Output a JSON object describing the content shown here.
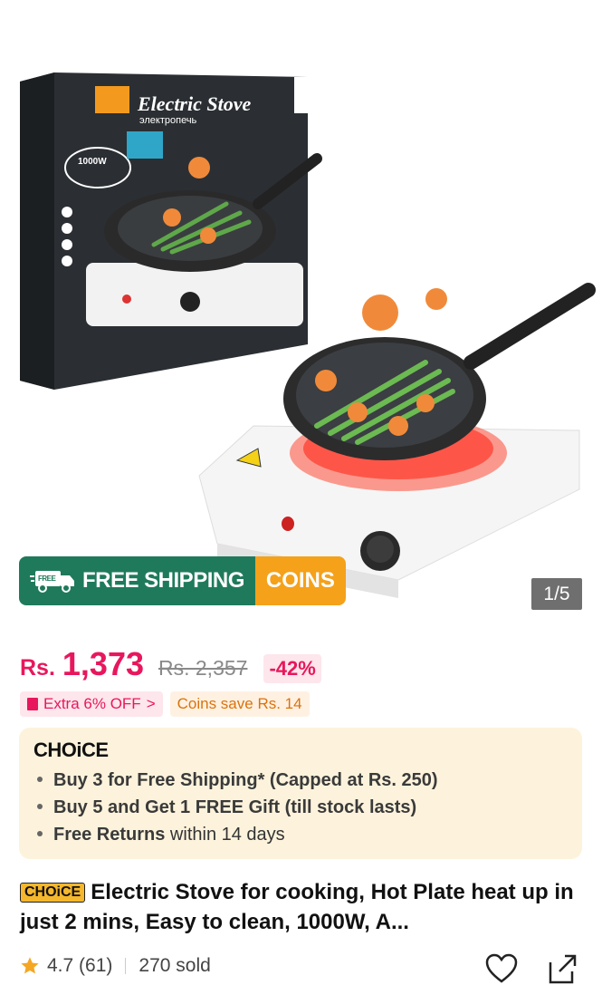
{
  "hero": {
    "box_title": "Electric Stove",
    "box_subtitle": "электропечь",
    "box_power": "1000W",
    "image_counter": "1/5"
  },
  "badges": {
    "free_label": "FREE",
    "shipping": "FREE SHIPPING",
    "coins": "COINS"
  },
  "price": {
    "currency": "Rs.",
    "current": "1,373",
    "original": "Rs. 2,357",
    "discount": "-42%"
  },
  "promos": {
    "extra": "Extra 6% OFF",
    "extra_chevron": ">",
    "coins_save": "Coins save Rs. 14"
  },
  "choice": {
    "logo": "CHOiCE",
    "bullet1": "Buy 3 for  Free Shipping* (Capped at Rs. 250)",
    "bullet2": "Buy 5 and Get 1 FREE Gift (till stock lasts)",
    "bullet3_bold": "Free Returns",
    "bullet3_rest": " within 14 days"
  },
  "product": {
    "tag": "CHOiCE",
    "title": "Electric Stove for cooking, Hot Plate heat up in just 2 mins, Easy to clean, 1000W, A..."
  },
  "rating": {
    "score": "4.7",
    "count": "(61)",
    "sold": "270 sold"
  },
  "colors": {
    "accent": "#e8175d",
    "shipping_green": "#1f7a5c",
    "coins_orange": "#f5a11a",
    "choice_bg": "#fdf3dc"
  },
  "icons": [
    "truck-icon",
    "gift-icon",
    "star-icon",
    "heart-icon",
    "share-icon"
  ]
}
